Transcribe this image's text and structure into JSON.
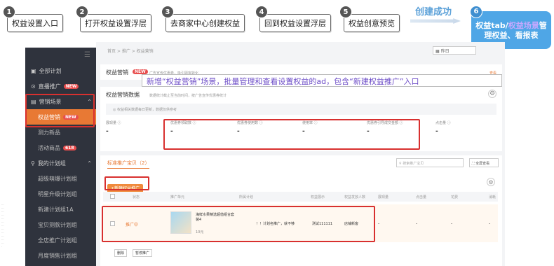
{
  "steps": [
    {
      "num": "1",
      "label": "权益设置入口"
    },
    {
      "num": "2",
      "label": "打开权益设置浮层"
    },
    {
      "num": "3",
      "label": "去商家中心创建权益"
    },
    {
      "num": "4",
      "label": "回到权益设置浮层"
    },
    {
      "num": "5",
      "label": "权益创意预览"
    }
  ],
  "success_label": "创建成功",
  "final_step": {
    "num": "6",
    "prefix": "权益tab/",
    "highlight": "权益场景",
    "suffix": "管理权益、看报表"
  },
  "banner": "新增“权益营销”场景，批量管理和查看设置权益的ad，包含“新建权益推广”入口",
  "sidebar": {
    "collapse": "☰",
    "items": [
      {
        "label": "全部计划",
        "badge": ""
      },
      {
        "label": "直播推广",
        "badge": "NEW"
      },
      {
        "label": "营销场景",
        "badge": ""
      },
      {
        "label": "权益营销",
        "badge": "NEW"
      },
      {
        "label": "测力新品",
        "badge": ""
      },
      {
        "label": "活动商品",
        "badge": "618"
      },
      {
        "label": "我的计划组",
        "badge": ""
      },
      {
        "label": "超级萌爆计划组",
        "badge": ""
      },
      {
        "label": "明星升级计划组",
        "badge": ""
      },
      {
        "label": "新建计划组1A",
        "badge": ""
      },
      {
        "label": "宝贝测款计划组",
        "badge": ""
      },
      {
        "label": "全店推广计划组",
        "badge": ""
      },
      {
        "label": "月度销售计划组",
        "badge": ""
      }
    ]
  },
  "main": {
    "breadcrumb": "首页 > 推广 > 权益营销",
    "date": "昨日",
    "title": "权益营销",
    "title_badge": "NEW",
    "title_desc": "广告宣传优惠券，吸引顾客转化",
    "title_link": "查看",
    "data_title": "权益营销数据",
    "data_desc": "数据统计截止至当前时间，按广告宣传优惠券统计",
    "notice": "◎ 权益相关数据每日更新，数据仅供参考",
    "metrics": [
      {
        "label": "展现量 ⓘ",
        "value": "-"
      },
      {
        "label": "优惠券领取数 ⓘ",
        "value": "-"
      },
      {
        "label": "优惠券使用数 ⓘ",
        "value": "-"
      },
      {
        "label": "使用率 ⓘ",
        "value": "-"
      },
      {
        "label": "优惠券引导成交金额 ⓘ",
        "value": "-"
      },
      {
        "label": "点击量 ⓘ",
        "value": "-"
      }
    ],
    "list_tab": "标准推广宝贝（2）",
    "search_placeholder": "搜索推广宝贝",
    "expand": "全屏查看",
    "new_button": "+新建权益推广",
    "table_headers": [
      "状态",
      "推广单元",
      "所属计划",
      "权益展示",
      "权益发放人数",
      "展现量",
      "点击量",
      "花费",
      "消耗"
    ],
    "row": {
      "status": "推广中",
      "name": "海鲜水果精选超值组合套装4",
      "price": "10元",
      "plan": "！！计划名推广，就不够",
      "benefit": "测试111111",
      "receivers": "店铺新客",
      "v1": "-",
      "v2": "-",
      "v3": "-",
      "v4": "-"
    },
    "actions": [
      "删除",
      "暂停推广"
    ]
  }
}
